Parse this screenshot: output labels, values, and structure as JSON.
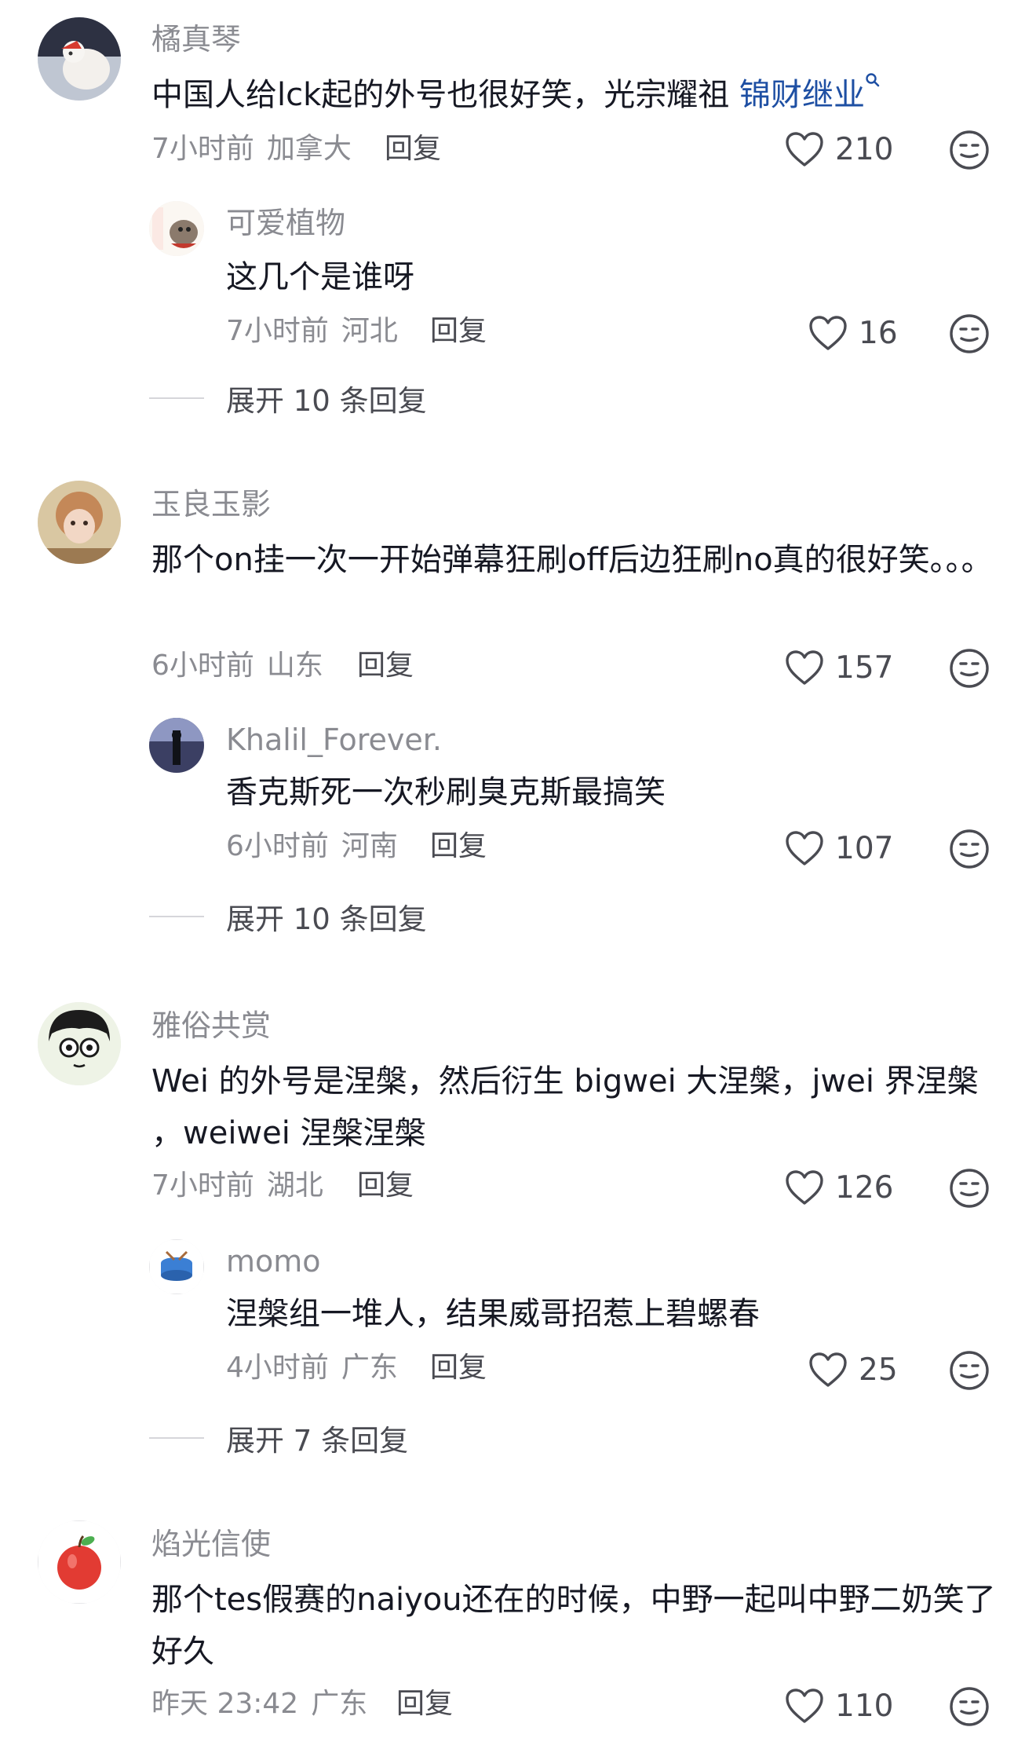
{
  "comments": [
    {
      "user": "橘真琴",
      "text_plain": "中国人给lck起的外号也很好笑，光宗耀祖 ",
      "text_tag": "锦财继业",
      "time": "7小时前",
      "location": "加拿大",
      "reply_label": "回复",
      "likes": "210",
      "replies": [
        {
          "user": "可爱植物",
          "text": "这几个是谁呀",
          "time": "7小时前",
          "location": "河北",
          "reply_label": "回复",
          "likes": "16"
        }
      ],
      "expand_label": "展开 10 条回复"
    },
    {
      "user": "玉良玉影",
      "text": "那个on挂一次一开始弹幕狂刷off后边狂刷no真的很好笑。。。",
      "time": "6小时前",
      "location": "山东",
      "reply_label": "回复",
      "likes": "157",
      "replies": [
        {
          "user": "Khalil_Forever.",
          "text": "香克斯死一次秒刷臭克斯最搞笑",
          "time": "6小时前",
          "location": "河南",
          "reply_label": "回复",
          "likes": "107"
        }
      ],
      "expand_label": "展开 10 条回复"
    },
    {
      "user": "雅俗共赏",
      "text": "Wei 的外号是涅槃，然后衍生 bigwei 大涅槃，jwei 界涅槃 ，weiwei 涅槃涅槃",
      "time": "7小时前",
      "location": "湖北",
      "reply_label": "回复",
      "likes": "126",
      "replies": [
        {
          "user": "momo",
          "text": "涅槃组一堆人，结果威哥招惹上碧螺春",
          "time": "4小时前",
          "location": "广东",
          "reply_label": "回复",
          "likes": "25"
        }
      ],
      "expand_label": "展开 7 条回复"
    },
    {
      "user": "焰光信使",
      "text": "那个tes假赛的naiyou还在的时候，中野一起叫中野二奶笑了好久",
      "time": "昨天 23:42",
      "location": "广东",
      "reply_label": "回复",
      "likes": "110"
    }
  ],
  "icons": {
    "like": "heart-outline-icon",
    "dislike": "meh-face-icon",
    "search": "search-icon"
  },
  "colors": {
    "name": "#8a8b91",
    "text": "#161823",
    "tag": "#1e4fa3",
    "meta": "#8a8b91",
    "action": "#4a4b52"
  }
}
